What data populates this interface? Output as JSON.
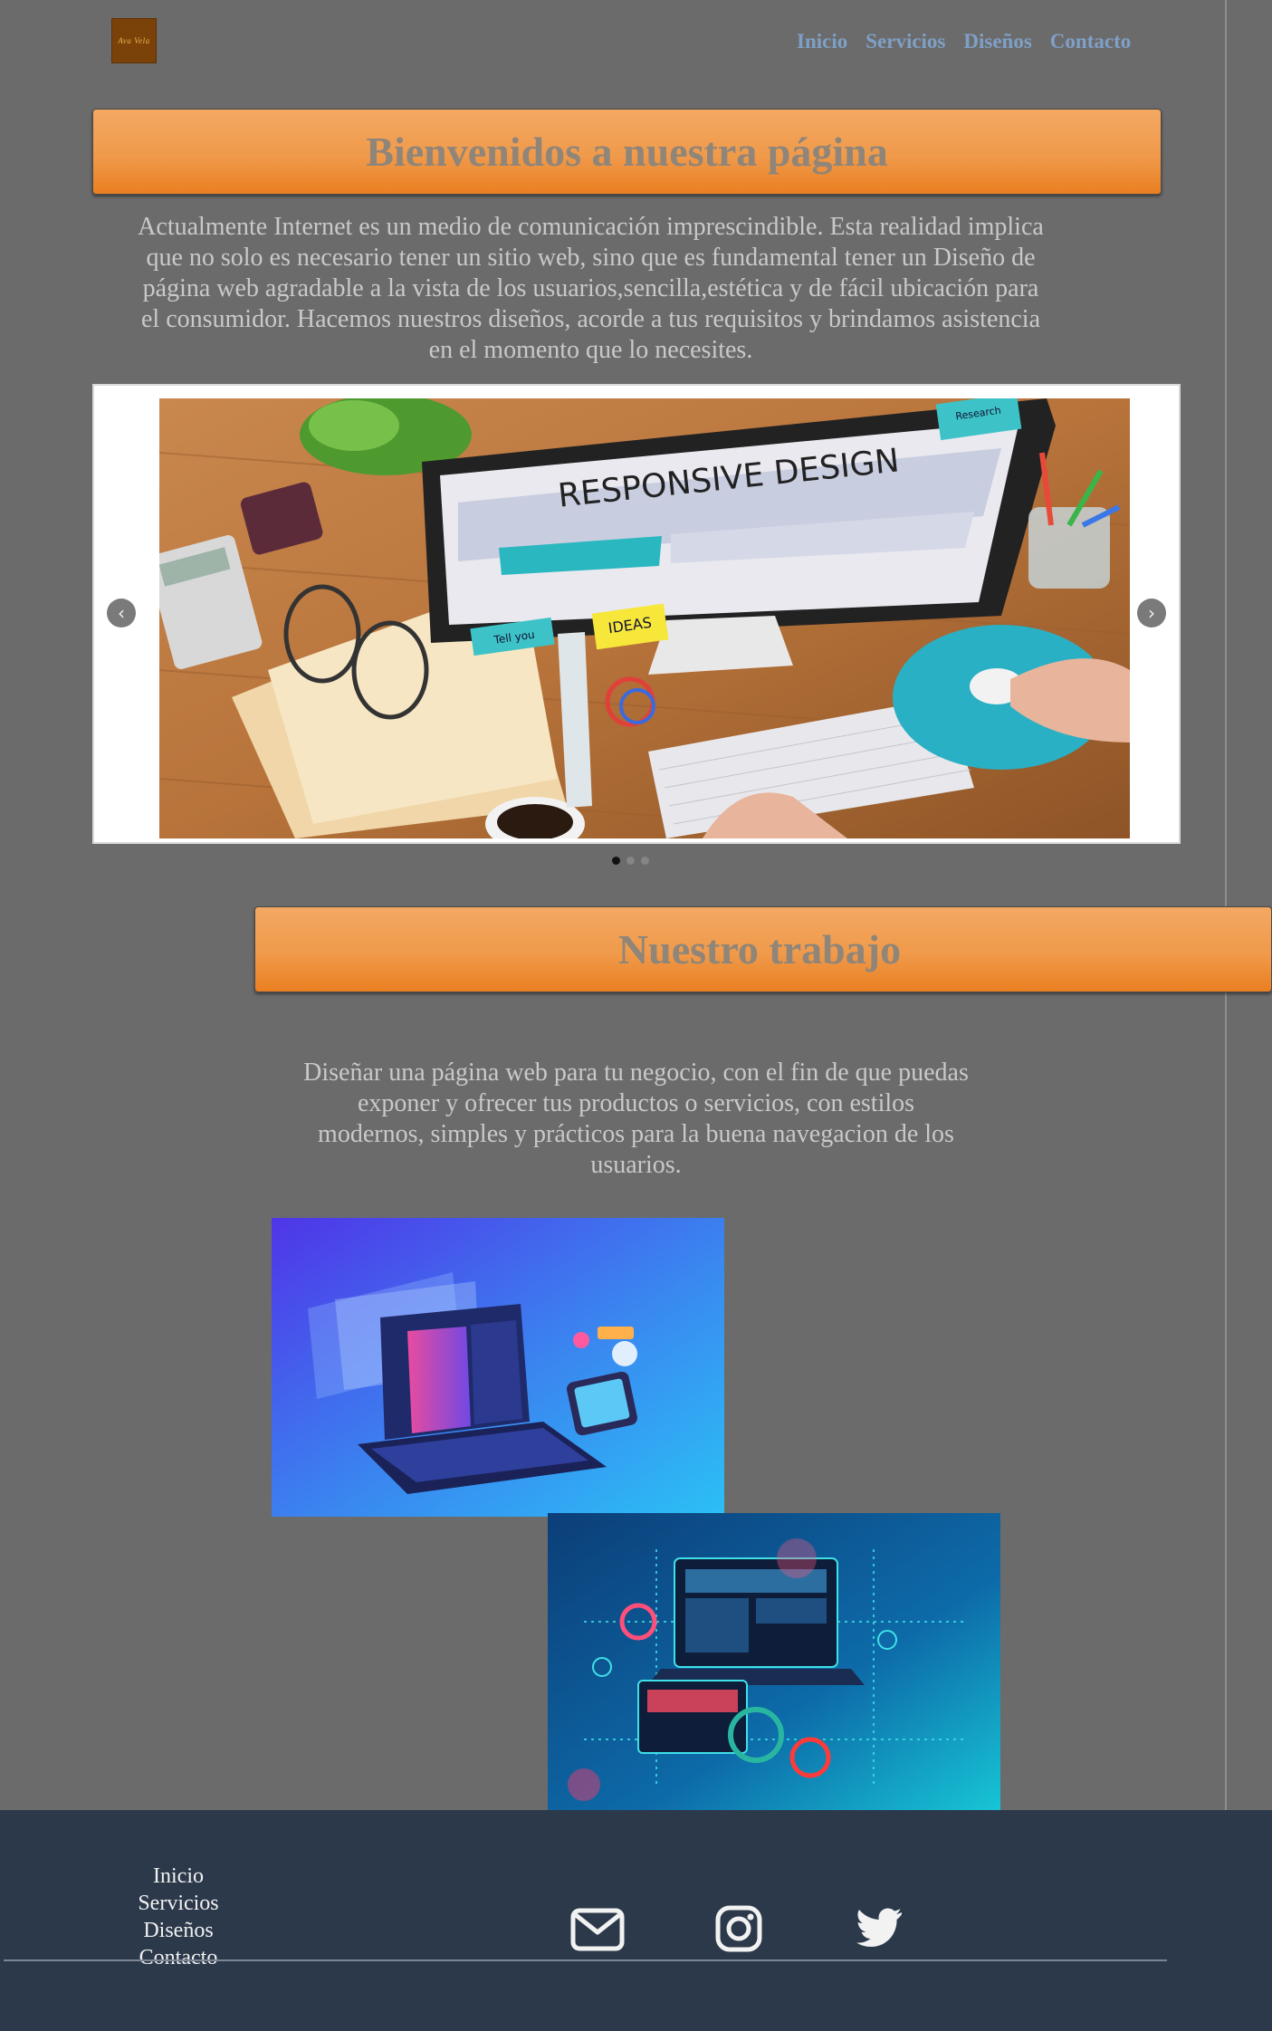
{
  "header": {
    "logo_text": "Ava Vela",
    "nav": [
      "Inicio",
      "Servicios",
      "Diseños",
      "Contacto"
    ]
  },
  "welcome": {
    "title": "Bienvenidos a nuestra página",
    "text": "Actualmente Internet es un medio de comunicación imprescindible. Esta realidad implica que no solo es necesario tener un sitio web, sino que es fundamental tener un Diseño de página web agradable a la vista de los usuarios,sencilla,estética y de fácil ubicación para el consumidor. Hacemos nuestros diseños, acorde a tus requisitos y brindamos asistencia en el momento que lo necesites."
  },
  "carousel": {
    "slide_heading": "RESPONSIVE DESIGN",
    "note_ideas": "IDEAS",
    "note_tell": "Tell you",
    "note_research": "Research",
    "slide_count": 3,
    "active_index": 0,
    "prev_icon": "chevron-left-icon",
    "next_icon": "chevron-right-icon"
  },
  "work": {
    "title": "Nuestro trabajo",
    "text": "Diseñar una página web para tu negocio, con el fin de que puedas exponer y ofrecer tus productos o servicios, con estilos modernos, simples y prácticos para la buena navegacion de los usuarios."
  },
  "footer": {
    "links": [
      "Inicio",
      "Servicios",
      "Diseños",
      "Contacto"
    ],
    "social_icons": [
      "mail-icon",
      "instagram-icon",
      "twitter-icon"
    ]
  },
  "colors": {
    "background": "#6b6b6b",
    "banner_orange": "#f09a4b",
    "nav_link": "#7fa0c6",
    "footer_bg": "#2c394b"
  }
}
